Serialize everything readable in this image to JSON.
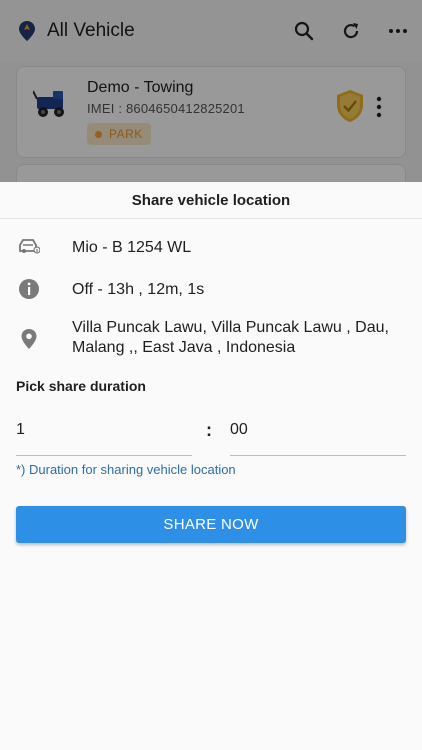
{
  "appbar": {
    "title": "All Vehicle",
    "icons": [
      "app-logo",
      "search-icon",
      "refresh-icon",
      "more-vertical-icon"
    ]
  },
  "vehicle_card": {
    "name": "Demo - Towing",
    "imei": "IMEI : 8604650412825201",
    "status_badge": "PARK",
    "colors": {
      "badge_bg": "#fbe7c8",
      "badge_text": "#e39a2a",
      "shield": "#f0b429"
    }
  },
  "sheet": {
    "title": "Share vehicle location",
    "vehicle_plate": "Mio - B 1254 WL",
    "status_info": "Off - 13h , 12m, 1s",
    "address": "Villa Puncak Lawu, Villa Puncak Lawu , Dau, Malang ,, East Java , Indonesia",
    "pick_label": "Pick share duration",
    "hours_value": "1",
    "separator": ":",
    "minutes_value": "00",
    "note": "*) Duration for sharing vehicle location",
    "share_button": "SHARE NOW",
    "colors": {
      "accent": "#2e8fe6",
      "note": "#2c6ea5"
    }
  }
}
